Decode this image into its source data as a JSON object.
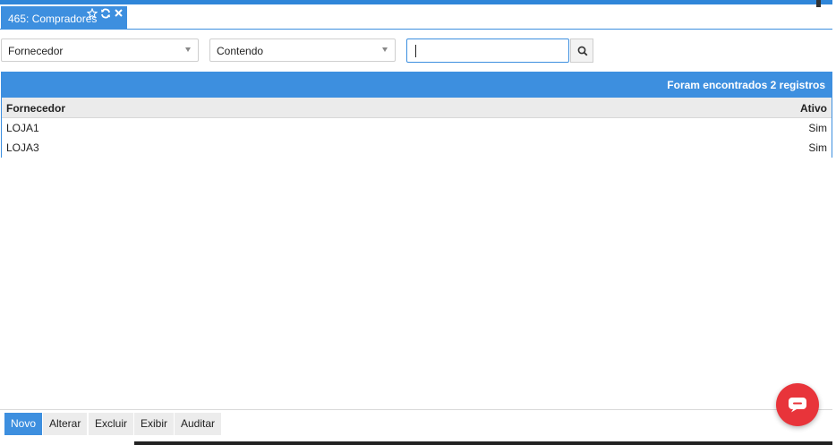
{
  "tab": {
    "title": "465: Compradores",
    "icons": [
      "star-icon",
      "refresh-icon",
      "close-icon"
    ]
  },
  "filters": {
    "field_select": "Fornecedor",
    "operator_select": "Contendo",
    "search_value": "",
    "search_button_icon": "search-icon"
  },
  "grid": {
    "count_text": "Foram encontrados 2 registros",
    "columns": [
      "Fornecedor",
      "Ativo"
    ],
    "rows": [
      {
        "fornecedor": "LOJA1",
        "ativo": "Sim"
      },
      {
        "fornecedor": "LOJA3",
        "ativo": "Sim"
      }
    ]
  },
  "footer": {
    "buttons": [
      "Novo",
      "Alterar",
      "Excluir",
      "Exibir",
      "Auditar"
    ]
  },
  "chat": {
    "icon": "chat-icon"
  },
  "colors": {
    "accent": "#3d8fdf",
    "chat": "#e8343a"
  }
}
